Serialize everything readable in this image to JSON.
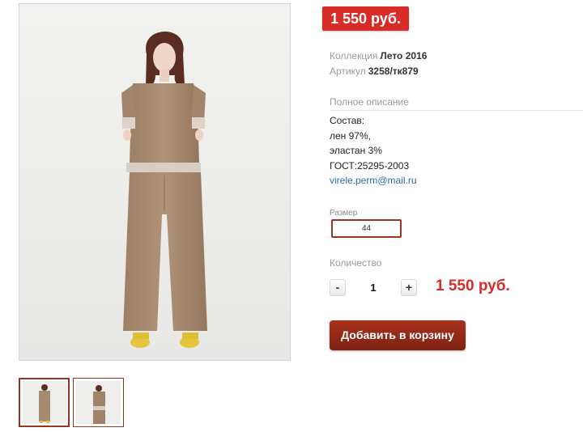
{
  "product": {
    "price_badge": "1 550 руб.",
    "collection_label": "Коллекция",
    "collection_value": "Лето 2016",
    "sku_label": "Артикул",
    "sku_value": "3258/тк879",
    "description_heading": "Полное описание",
    "description_lines": [
      "Состав:",
      "лен 97%,",
      "эластан 3%",
      "ГОСТ:25295-2003"
    ],
    "email": "virele.perm@mail.ru"
  },
  "size": {
    "label": "Размер",
    "value": "44"
  },
  "quantity": {
    "label": "Количество",
    "minus": "-",
    "value": "1",
    "plus": "+"
  },
  "total_price": "1 550 руб.",
  "add_to_cart_label": "Добавить в корзину",
  "colors": {
    "accent_red": "#d92b27",
    "button_brown": "#9b3522",
    "fabric": "#a98a6f"
  }
}
